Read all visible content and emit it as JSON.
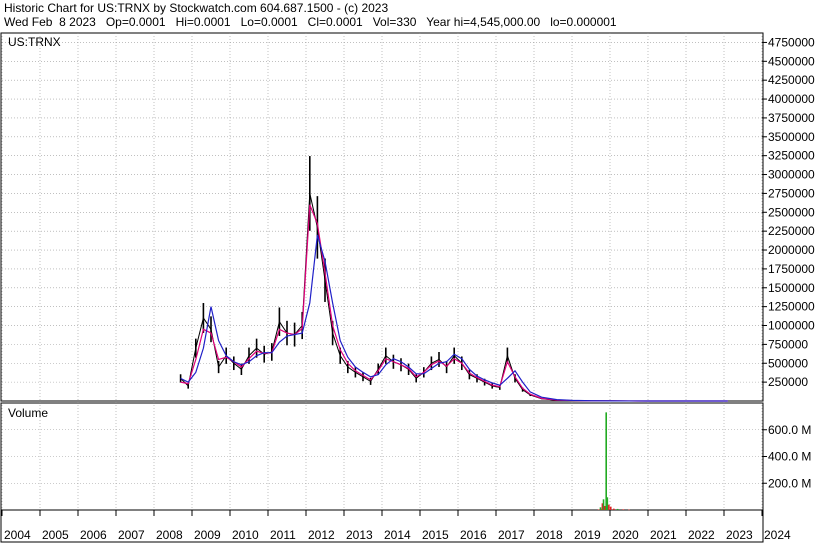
{
  "header": {
    "line1": "Historic Chart for US:TRNX by Stockwatch.com 604.687.1500 - (c) 2023",
    "line2": "Wed Feb  8 2023   Op=0.0001   Hi=0.0001   Lo=0.0001   Cl=0.0001   Vol=330   Year hi=4,545,000.00   lo=0.000001"
  },
  "colors": {
    "price_bars": "#000000",
    "ma_short": "#e0007a",
    "ma_long": "#2020c8",
    "volume_up": "#22aa22",
    "volume_down": "#dd2222",
    "grid": "#9a9a9a"
  },
  "chart_data": [
    {
      "type": "line",
      "title": "US:TRNX",
      "xlabel": "",
      "ylabel": "",
      "grid": true,
      "ylim": [
        0,
        4875000
      ],
      "yticks": [
        250000,
        500000,
        750000,
        1000000,
        1250000,
        1500000,
        1750000,
        2000000,
        2250000,
        2500000,
        2750000,
        3000000,
        3250000,
        3500000,
        3750000,
        4000000,
        4250000,
        4500000,
        4750000
      ],
      "ytick_labels": [
        "250000",
        "500000",
        "750000",
        "1000000",
        "1250000",
        "1500000",
        "1750000",
        "2000000",
        "2250000",
        "2500000",
        "2750000",
        "3000000",
        "3250000",
        "3500000",
        "3750000",
        "4000000",
        "4250000",
        "4500000",
        "4750000"
      ],
      "x_years": [
        "2004",
        "2005",
        "2006",
        "2007",
        "2008",
        "2009",
        "2010",
        "2011",
        "2012",
        "2013",
        "2014",
        "2015",
        "2016",
        "2017",
        "2018",
        "2019",
        "2020",
        "2021",
        "2022",
        "2023",
        "2024"
      ],
      "x": [
        2008.7,
        2008.9,
        2009.1,
        2009.3,
        2009.5,
        2009.7,
        2009.9,
        2010.1,
        2010.3,
        2010.5,
        2010.7,
        2010.9,
        2011.1,
        2011.3,
        2011.5,
        2011.7,
        2011.9,
        2012.1,
        2012.3,
        2012.5,
        2012.7,
        2012.9,
        2013.1,
        2013.3,
        2013.5,
        2013.7,
        2013.9,
        2014.1,
        2014.3,
        2014.5,
        2014.7,
        2014.9,
        2015.1,
        2015.3,
        2015.5,
        2015.7,
        2015.9,
        2016.1,
        2016.3,
        2016.5,
        2016.7,
        2016.9,
        2017.1,
        2017.3,
        2017.5,
        2017.7,
        2017.9,
        2018.2,
        2018.6,
        2019.0,
        2019.5,
        2020.0,
        2020.5,
        2021.0,
        2022.0,
        2023.1
      ],
      "series": [
        {
          "kind": "price",
          "values": [
            300000,
            200000,
            700000,
            1100000,
            950000,
            450000,
            600000,
            500000,
            420000,
            600000,
            700000,
            620000,
            650000,
            1050000,
            900000,
            880000,
            1000000,
            2750000,
            2300000,
            1600000,
            900000,
            600000,
            450000,
            380000,
            320000,
            260000,
            420000,
            600000,
            520000,
            480000,
            420000,
            300000,
            380000,
            500000,
            550000,
            450000,
            600000,
            500000,
            350000,
            300000,
            250000,
            200000,
            180000,
            600000,
            300000,
            150000,
            80000,
            30000,
            10000,
            5000,
            2000,
            1000,
            500,
            200,
            100,
            100
          ]
        },
        {
          "kind": "ma_short",
          "values": [
            250000,
            230000,
            550000,
            950000,
            900000,
            550000,
            580000,
            520000,
            450000,
            560000,
            660000,
            630000,
            640000,
            950000,
            900000,
            880000,
            960000,
            2600000,
            2350000,
            1700000,
            1000000,
            680000,
            500000,
            400000,
            340000,
            280000,
            400000,
            560000,
            520000,
            480000,
            430000,
            320000,
            380000,
            480000,
            530000,
            460000,
            560000,
            500000,
            370000,
            310000,
            260000,
            210000,
            190000,
            520000,
            320000,
            170000,
            90000,
            35000,
            12000,
            6000,
            2500,
            1200,
            600,
            250,
            120,
            100
          ]
        },
        {
          "kind": "ma_long",
          "values": [
            300000,
            250000,
            380000,
            700000,
            1250000,
            800000,
            600000,
            520000,
            480000,
            520000,
            600000,
            640000,
            640000,
            780000,
            860000,
            880000,
            900000,
            1300000,
            2200000,
            1850000,
            1300000,
            800000,
            580000,
            450000,
            380000,
            320000,
            350000,
            480000,
            560000,
            520000,
            450000,
            360000,
            360000,
            430000,
            500000,
            520000,
            620000,
            560000,
            420000,
            330000,
            280000,
            240000,
            210000,
            300000,
            400000,
            250000,
            120000,
            50000,
            18000,
            8000,
            3000,
            1500,
            700,
            300,
            150,
            100
          ]
        }
      ]
    },
    {
      "type": "bar",
      "title": "Volume",
      "xlabel": "",
      "ylabel": "",
      "ylim": [
        0,
        800000000
      ],
      "yticks": [
        200000000,
        400000000,
        600000000
      ],
      "ytick_labels": [
        "200.0 M",
        "400.0 M",
        "600.0 M"
      ],
      "x": [
        2019.7,
        2019.75,
        2019.8,
        2019.83,
        2019.86,
        2019.9,
        2019.93,
        2019.97,
        2020.02,
        2020.1,
        2020.2,
        2020.35,
        2020.5
      ],
      "values": [
        4000000,
        20000000,
        50000000,
        80000000,
        30000000,
        730000000,
        95000000,
        40000000,
        25000000,
        10000000,
        8000000,
        5000000,
        3000000
      ],
      "directions": [
        "down",
        "up",
        "down",
        "up",
        "down",
        "up",
        "up",
        "down",
        "down",
        "down",
        "up",
        "down",
        "down"
      ]
    }
  ]
}
